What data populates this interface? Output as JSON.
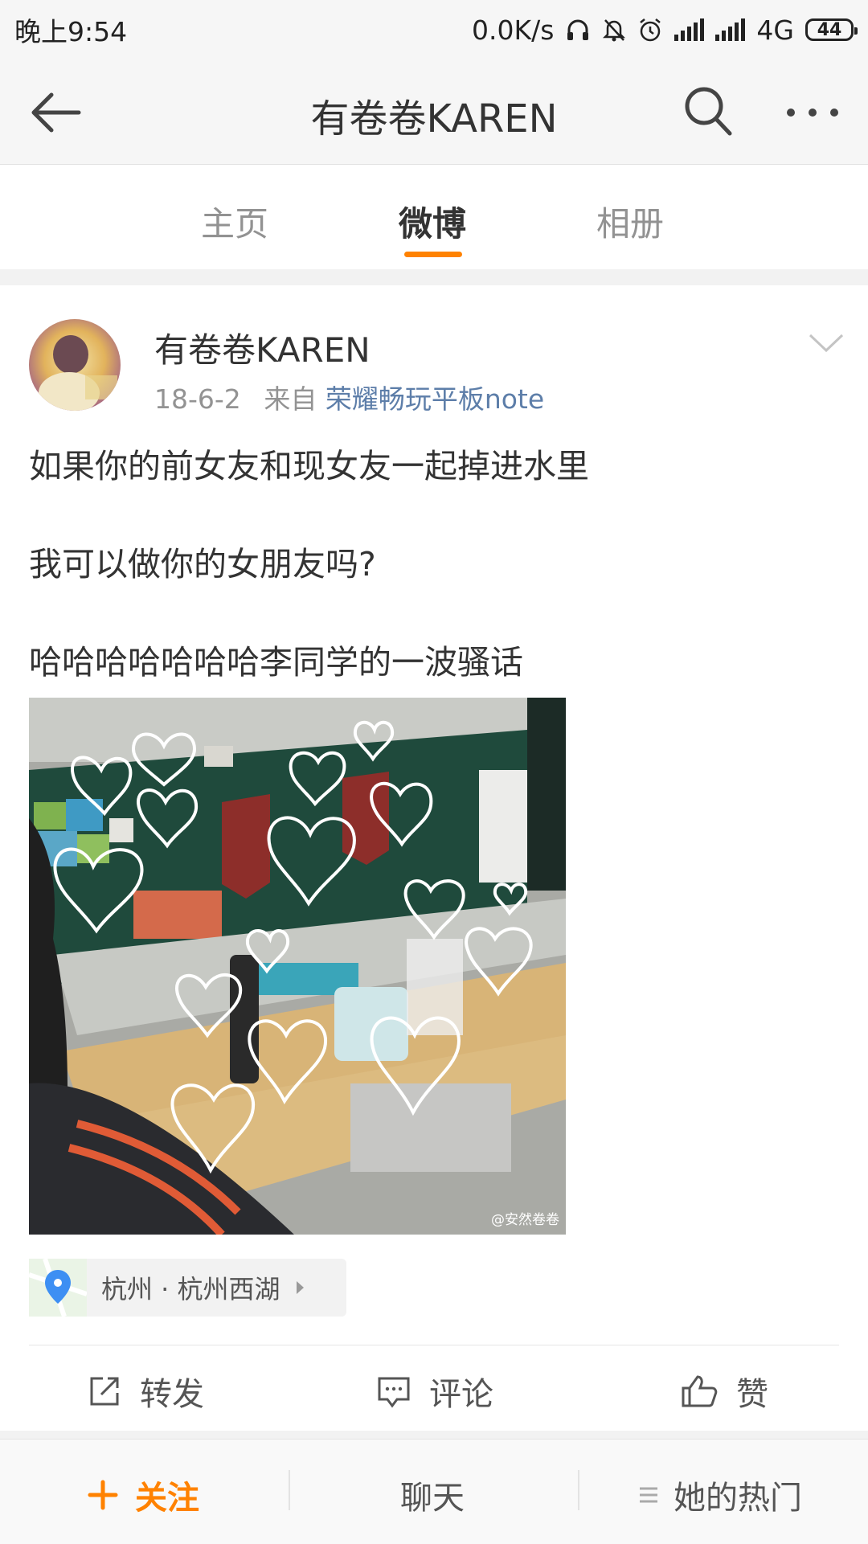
{
  "status_bar": {
    "time": "晚上9:54",
    "speed": "0.0K/s",
    "network": "4G",
    "battery": "44"
  },
  "header": {
    "title": "有卷卷KAREN",
    "back_icon": "back-arrow-icon",
    "search_icon": "search-icon",
    "more_icon": "more-icon"
  },
  "tabs": [
    {
      "label": "主页",
      "active": false
    },
    {
      "label": "微博",
      "active": true
    },
    {
      "label": "相册",
      "active": false
    }
  ],
  "post": {
    "author": "有卷卷KAREN",
    "date": "18-6-2",
    "source_prefix": "来自",
    "source": "荣耀畅玩平板note",
    "lines": [
      "如果你的前女友和现女友一起掉进水里",
      "我可以做你的女朋友吗?",
      "哈哈哈哈哈哈哈李同学的一波骚话"
    ],
    "image_watermark": "@安然卷卷",
    "location": "杭州 · 杭州西湖"
  },
  "actions": {
    "repost": "转发",
    "comment": "评论",
    "like": "赞"
  },
  "bottom_bar": {
    "follow": "关注",
    "chat": "聊天",
    "hot": "她的热门"
  },
  "colors": {
    "accent": "#ff8200",
    "link": "#5d7ea9"
  }
}
